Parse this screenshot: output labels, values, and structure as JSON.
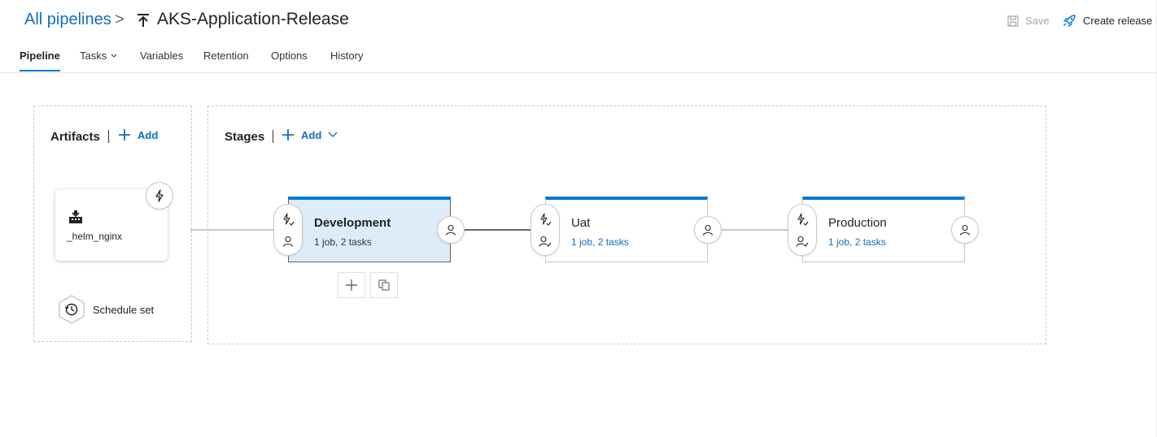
{
  "header": {
    "breadcrumb_root": "All pipelines",
    "breadcrumb_separator": ">",
    "pipeline_name": "AKS-Application-Release",
    "save_label": "Save",
    "create_release_label": "Create release"
  },
  "tabs": [
    {
      "label": "Pipeline",
      "active": true
    },
    {
      "label": "Tasks",
      "has_dropdown": true
    },
    {
      "label": "Variables"
    },
    {
      "label": "Retention"
    },
    {
      "label": "Options"
    },
    {
      "label": "History"
    }
  ],
  "artifacts": {
    "title": "Artifacts",
    "add_label": "Add",
    "items": [
      {
        "name": "_helm_nginx",
        "icon": "build-icon"
      }
    ],
    "schedule_label": "Schedule set"
  },
  "stages": {
    "title": "Stages",
    "add_label": "Add",
    "items": [
      {
        "name": "Development",
        "summary": "1 job, 2 tasks",
        "selected": true
      },
      {
        "name": "Uat",
        "summary": "1 job, 2 tasks",
        "selected": false
      },
      {
        "name": "Production",
        "summary": "1 job, 2 tasks",
        "selected": false
      }
    ]
  },
  "colors": {
    "accent": "#0078d4",
    "link": "#106ebe",
    "selected_stage_bg": "#deecf9"
  }
}
